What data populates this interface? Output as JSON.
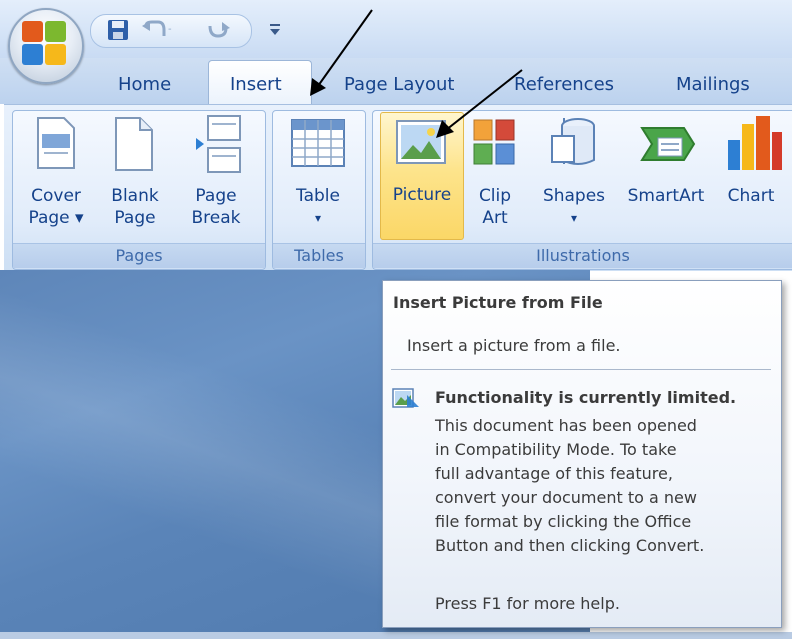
{
  "quick_access": {
    "save_icon": "save-icon",
    "undo_icon": "undo-icon",
    "redo_icon": "redo-icon",
    "customize_icon": "customize-qat-icon"
  },
  "office_button": {
    "icon": "office-logo-icon"
  },
  "tabs": [
    {
      "label": "Home"
    },
    {
      "label": "Insert"
    },
    {
      "label": "Page Layout"
    },
    {
      "label": "References"
    },
    {
      "label": "Mailings"
    }
  ],
  "ribbon": {
    "groups": {
      "pages": {
        "label": "Pages",
        "buttons": [
          {
            "line1": "Cover",
            "line2": "Page ▾",
            "icon": "cover-page-icon"
          },
          {
            "line1": "Blank",
            "line2": "Page",
            "icon": "blank-page-icon"
          },
          {
            "line1": "Page",
            "line2": "Break",
            "icon": "page-break-icon"
          }
        ]
      },
      "tables": {
        "label": "Tables",
        "buttons": [
          {
            "line1": "Table",
            "line2": "▾",
            "icon": "table-icon"
          }
        ]
      },
      "illustrations": {
        "label": "Illustrations",
        "buttons": [
          {
            "line1": "Picture",
            "line2": "",
            "icon": "picture-icon"
          },
          {
            "line1": "Clip",
            "line2": "Art",
            "icon": "clip-art-icon"
          },
          {
            "line1": "Shapes",
            "line2": "▾",
            "icon": "shapes-icon"
          },
          {
            "line1": "SmartArt",
            "line2": "",
            "icon": "smartart-icon"
          },
          {
            "line1": "Chart",
            "line2": "",
            "icon": "chart-icon"
          }
        ]
      }
    }
  },
  "tooltip": {
    "title": "Insert Picture from File",
    "description": "Insert a picture from a file.",
    "warning_icon": "compatibility-warning-icon",
    "warning_title": "Functionality is currently limited.",
    "warning_lines": [
      "This document has been opened",
      "in Compatibility Mode. To take",
      "full advantage of this feature,",
      "convert your document to a new",
      "file format by clicking the Office",
      "Button and then clicking Convert."
    ],
    "help": "Press F1 for more help."
  },
  "colors": {
    "tab_text": "#15428b",
    "group_label": "#3e6aaa",
    "picture_highlight": "#fbd767",
    "document_background": "#5e86b9"
  }
}
